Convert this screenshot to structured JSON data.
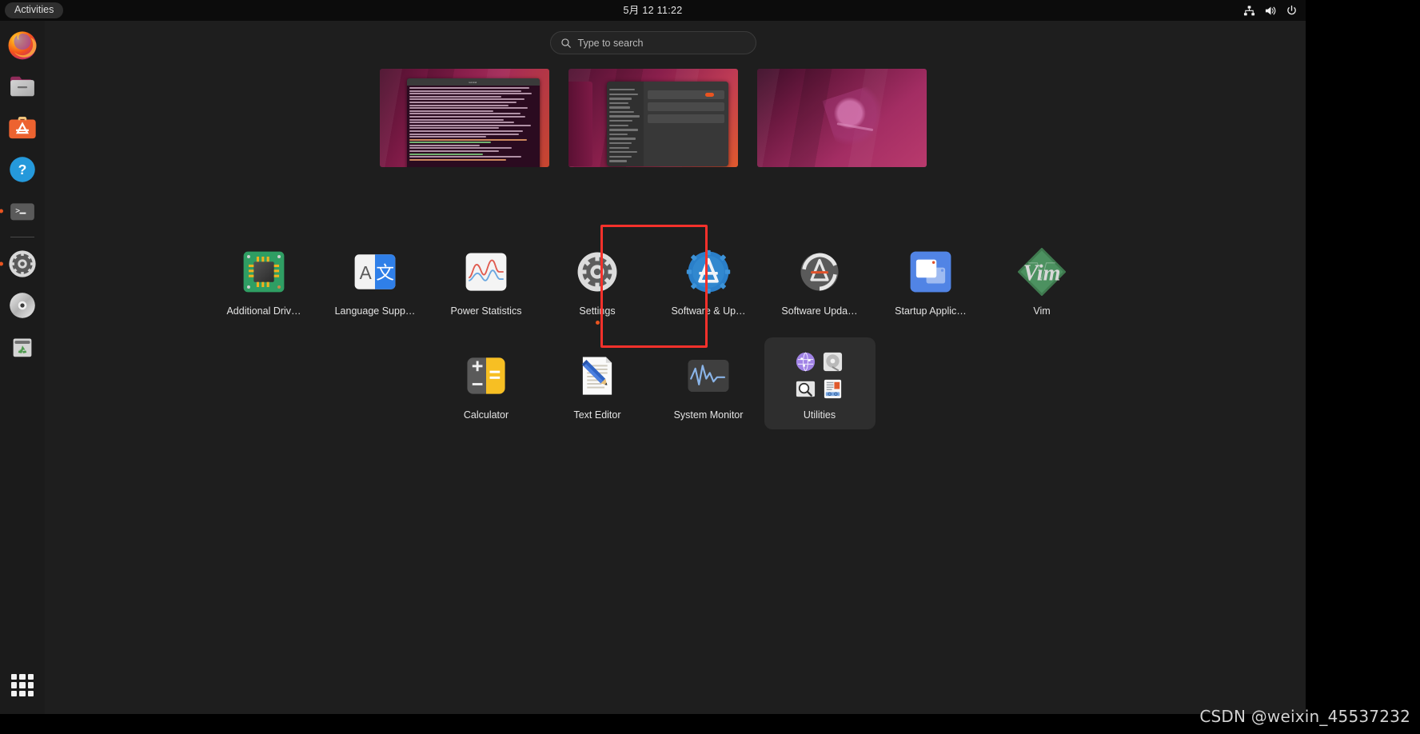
{
  "topbar": {
    "activities_label": "Activities",
    "clock": "5月 12  11:22",
    "status": [
      {
        "name": "network-wired-icon",
        "label": "Network"
      },
      {
        "name": "volume-icon",
        "label": "Volume"
      },
      {
        "name": "power-icon",
        "label": "Power"
      }
    ]
  },
  "search": {
    "placeholder": "Type to search",
    "value": "",
    "icon": "search-icon"
  },
  "dock": {
    "items": [
      {
        "name": "firefox",
        "label": "Firefox",
        "running": false
      },
      {
        "name": "files",
        "label": "Files",
        "running": false
      },
      {
        "name": "ubuntu-software",
        "label": "Ubuntu Software",
        "running": false
      },
      {
        "name": "help",
        "label": "Help",
        "running": false
      },
      {
        "name": "terminal",
        "label": "Terminal",
        "running": true
      },
      {
        "name": "settings",
        "label": "Settings",
        "running": true
      },
      {
        "name": "disc",
        "label": "CD/DVD Drive",
        "running": false
      },
      {
        "name": "trash",
        "label": "Trash",
        "running": false
      }
    ],
    "show_apps_label": "Show Applications"
  },
  "workspaces": [
    {
      "name": "workspace-1",
      "content": "terminal-window",
      "active": false
    },
    {
      "name": "workspace-2",
      "content": "settings-window",
      "active": true
    },
    {
      "name": "workspace-3",
      "content": "empty-desktop",
      "active": false
    }
  ],
  "apps": {
    "row1": [
      {
        "name": "additional-drivers",
        "label": "Additional Driv…",
        "icon": "chip-icon",
        "running": false,
        "highlighted": false
      },
      {
        "name": "language-support",
        "label": "Language Supp…",
        "icon": "translate-icon",
        "running": false,
        "highlighted": false
      },
      {
        "name": "power-statistics",
        "label": "Power Statistics",
        "icon": "waveform-icon",
        "running": false,
        "highlighted": false
      },
      {
        "name": "settings",
        "label": "Settings",
        "icon": "gear-icon",
        "running": true,
        "highlighted": false
      },
      {
        "name": "software-and-updates",
        "label": "Software & Up…",
        "icon": "software-updates-icon",
        "running": false,
        "highlighted": true
      },
      {
        "name": "software-updater",
        "label": "Software Upda…",
        "icon": "software-updater-icon",
        "running": false,
        "highlighted": false
      },
      {
        "name": "startup-applications",
        "label": "Startup Applic…",
        "icon": "startup-windows-icon",
        "running": false,
        "highlighted": false
      },
      {
        "name": "vim",
        "label": "Vim",
        "icon": "vim-icon",
        "running": false,
        "highlighted": false
      }
    ],
    "row2": [
      {
        "name": "calculator",
        "label": "Calculator",
        "icon": "calculator-icon",
        "running": false,
        "highlighted": false
      },
      {
        "name": "text-editor",
        "label": "Text Editor",
        "icon": "pencil-document-icon",
        "running": false,
        "highlighted": false
      },
      {
        "name": "system-monitor",
        "label": "System Monitor",
        "icon": "monitor-graph-icon",
        "running": false,
        "highlighted": false
      },
      {
        "name": "utilities",
        "label": "Utilities",
        "icon": "folder-icon",
        "running": false,
        "highlighted": false,
        "folder_items": [
          "network-globe-icon",
          "disks-icon",
          "document-viewer-icon",
          "document-scanner-icon"
        ]
      }
    ]
  },
  "highlight": {
    "color": "#f6312b",
    "target": "software-and-updates"
  },
  "watermark": "CSDN @weixin_45537232"
}
